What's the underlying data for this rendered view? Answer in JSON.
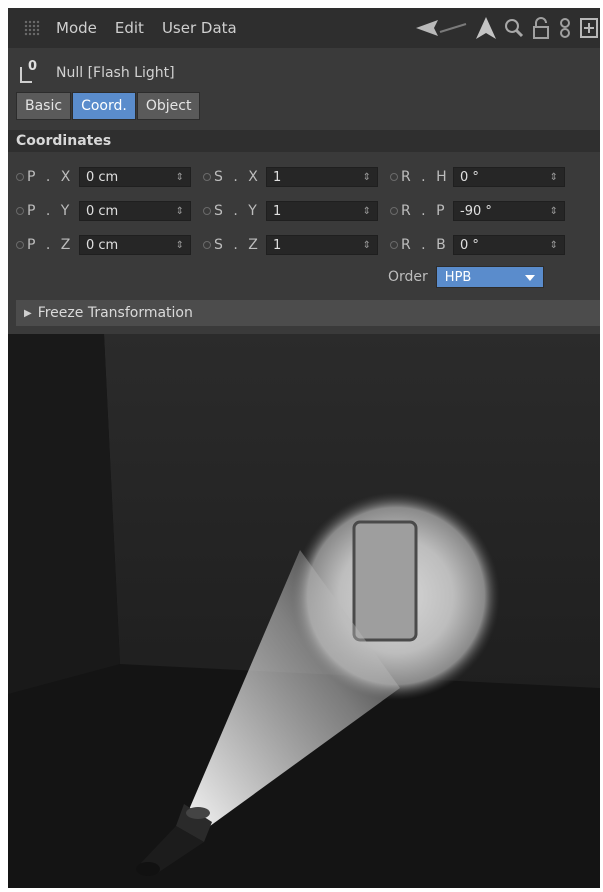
{
  "menubar": {
    "items": [
      "Mode",
      "Edit",
      "User Data"
    ],
    "icons": [
      "grip-icon",
      "back-arrow-icon",
      "up-arrow-icon",
      "search-icon",
      "lock-icon",
      "link-icon",
      "new-panel-icon"
    ]
  },
  "object": {
    "title": "Null [Flash Light]",
    "icon": "null-object-icon"
  },
  "tabs": [
    {
      "label": "Basic",
      "active": false
    },
    {
      "label": "Coord.",
      "active": true
    },
    {
      "label": "Object",
      "active": false
    }
  ],
  "section": {
    "title": "Coordinates"
  },
  "fields": {
    "p_x": {
      "label": "P . X",
      "value": "0 cm"
    },
    "p_y": {
      "label": "P . Y",
      "value": "0 cm"
    },
    "p_z": {
      "label": "P . Z",
      "value": "0 cm"
    },
    "s_x": {
      "label": "S . X",
      "value": "1"
    },
    "s_y": {
      "label": "S . Y",
      "value": "1"
    },
    "s_z": {
      "label": "S . Z",
      "value": "1"
    },
    "r_h": {
      "label": "R . H",
      "value": "0 °"
    },
    "r_p": {
      "label": "R . P",
      "value": "-90 °"
    },
    "r_b": {
      "label": "R . B",
      "value": "0 °"
    }
  },
  "order": {
    "label": "Order",
    "value": "HPB"
  },
  "freeze": {
    "label": "Freeze Transformation"
  },
  "colors": {
    "accent": "#5a8ccc",
    "panel": "#3a3a3a",
    "menubar": "#2e2e2e"
  }
}
